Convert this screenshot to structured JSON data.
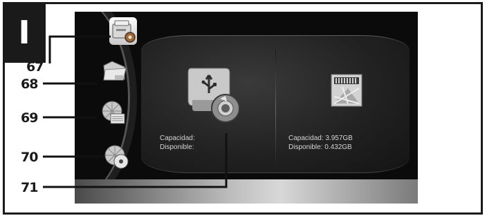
{
  "step_badge": "I",
  "menu": {
    "items": [
      {
        "icon": "settings-icon",
        "selected": true
      },
      {
        "icon": "folder-icon",
        "selected": false
      },
      {
        "icon": "media-grid-icon",
        "selected": false
      },
      {
        "icon": "media-disc-icon",
        "selected": false
      }
    ]
  },
  "callouts": {
    "c67": "67",
    "c68": "68",
    "c69": "69",
    "c70": "70",
    "c71": "71"
  },
  "usb": {
    "capacity_label": "Capacidad:",
    "available_label": "Disponible:"
  },
  "sd": {
    "capacity_text": "Capacidad: 3.957GB",
    "available_text": "Disponible: 0.432GB"
  }
}
